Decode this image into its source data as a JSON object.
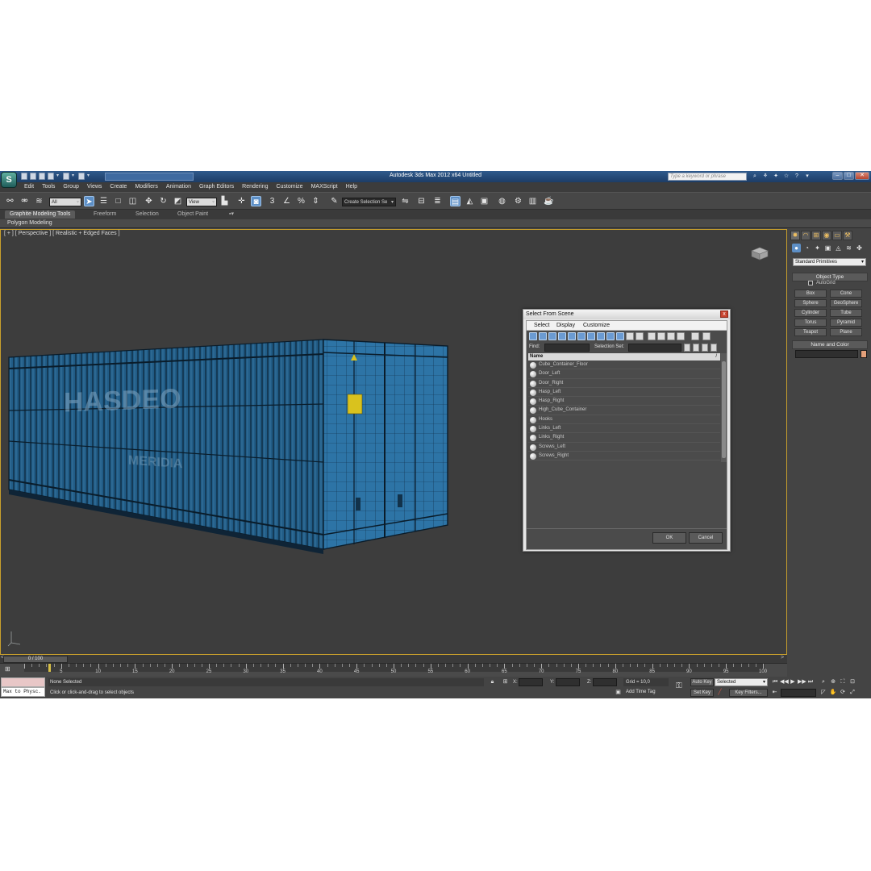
{
  "app": {
    "logo_letter": "S",
    "title": "Autodesk 3ds Max  2012 x64      Untitled",
    "search_placeholder": "Type a keyword or phrase",
    "window_controls": [
      "–",
      "□",
      "✕"
    ]
  },
  "menu": [
    "Edit",
    "Tools",
    "Group",
    "Views",
    "Create",
    "Modifiers",
    "Animation",
    "Graph Editors",
    "Rendering",
    "Customize",
    "MAXScript",
    "Help"
  ],
  "main_toolbar": {
    "selection_filter": "All",
    "reference_coord": "View",
    "named_selection": "Create Selection Se",
    "snap_label": "3"
  },
  "ribbon": {
    "tabs": [
      "Graphite Modeling Tools",
      "Freeform",
      "Selection",
      "Object Paint"
    ],
    "active_tab": "Graphite Modeling Tools",
    "sub_label": "Polygon Modeling"
  },
  "viewport": {
    "label": "[ + ] [ Perspective ] [ Realistic + Edged Faces ]",
    "active_border_color": "#c9a02c"
  },
  "dialog": {
    "title": "Select From Scene",
    "close": "x",
    "menu": [
      "Select",
      "Display",
      "Customize"
    ],
    "find_label": "Find:",
    "selection_set_label": "Selection Set:",
    "column_header": "Name",
    "sort_indicator": "/",
    "objects": [
      "Cube_Container_Floor",
      "Door_Left",
      "Door_Right",
      "Hasp_Left",
      "Hasp_Right",
      "High_Cube_Container",
      "Hooks",
      "Links_Left",
      "Links_Right",
      "Screws_Left",
      "Screws_Right"
    ],
    "ok_label": "OK",
    "cancel_label": "Cancel"
  },
  "command_panel": {
    "primitive_type": "Standard Primitives",
    "object_type_title": "Object Type",
    "autogrid_label": "AutoGrid",
    "primitives": [
      "Box",
      "Cone",
      "Sphere",
      "GeoSphere",
      "Cylinder",
      "Tube",
      "Torus",
      "Pyramid",
      "Teapot",
      "Plane"
    ],
    "name_color_title": "Name and Color",
    "object_color": "#e4a07a"
  },
  "timeline": {
    "slider_label": "0 / 100",
    "tick_labels": [
      "0",
      "5",
      "10",
      "15",
      "20",
      "25",
      "30",
      "35",
      "40",
      "45",
      "50",
      "55",
      "60",
      "65",
      "70",
      "75",
      "80",
      "85",
      "90",
      "95",
      "100"
    ]
  },
  "status": {
    "maxscript_text": "Max to Physc.",
    "selection": "None Selected",
    "prompt": "Click or click-and-drag to select objects",
    "x_label": "X:",
    "y_label": "Y:",
    "z_label": "Z:",
    "grid": "Grid = 10,0",
    "add_time_tag": "Add Time Tag",
    "auto_key": "Auto Key",
    "set_key": "Set Key",
    "key_mode": "Selected",
    "key_filters": "Key Filters..."
  }
}
